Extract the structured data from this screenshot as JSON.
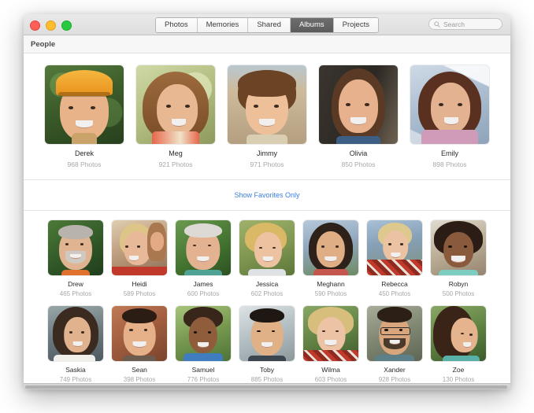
{
  "window": {
    "traffic_lights": [
      "close",
      "minimize",
      "zoom"
    ],
    "tabs": [
      {
        "label": "Photos",
        "selected": false
      },
      {
        "label": "Memories",
        "selected": false
      },
      {
        "label": "Shared",
        "selected": false
      },
      {
        "label": "Albums",
        "selected": true
      },
      {
        "label": "Projects",
        "selected": false
      }
    ],
    "search": {
      "placeholder": "Search",
      "value": ""
    }
  },
  "section": {
    "title": "People"
  },
  "favorites_link": {
    "label": "Show Favorites Only",
    "color": "#3b7fe0"
  },
  "favorites": [
    {
      "name": "Derek",
      "count": "968 Photos",
      "art": {
        "bg1": "#4a6b35",
        "bg2": "#2e4722",
        "skin": "#e8b389",
        "hair": "#6d523c",
        "cloth": "#caa36b",
        "helmet": "#f0a128",
        "helmet_on": true
      }
    },
    {
      "name": "Meg",
      "count": "921 Photos",
      "art": {
        "bg1": "#c3cf9a",
        "bg2": "#9aa96d",
        "skin": "#e7b892",
        "hair": "#8a5c33",
        "cloth": "#e8654a",
        "helmet_on": false
      }
    },
    {
      "name": "Jimmy",
      "count": "971 Photos",
      "art": {
        "bg1": "#cbb79a",
        "bg2": "#b6a184",
        "skin": "#eec09a",
        "hair": "#6b4426",
        "cloth": "#d9cdb2",
        "helmet_on": false
      }
    },
    {
      "name": "Olivia",
      "count": "850 Photos",
      "art": {
        "bg1": "#4a443c",
        "bg2": "#2a2622",
        "skin": "#e6b18c",
        "hair": "#5a3a24",
        "cloth": "#3d5f86",
        "helmet_on": false
      }
    },
    {
      "name": "Emily",
      "count": "898 Photos",
      "art": {
        "bg1": "#c7d4e2",
        "bg2": "#9aaec4",
        "skin": "#e3b291",
        "hair": "#5a3120",
        "cloth": "#cf9bb8",
        "helmet_on": false
      }
    }
  ],
  "people_rows": [
    [
      {
        "name": "Drew",
        "count": "465 Photos",
        "art": {
          "bg1": "#3f6b34",
          "bg2": "#24461f",
          "skin": "#e0b391",
          "hair": "#b9b3ad",
          "cloth": "#e0712f"
        }
      },
      {
        "name": "Heidi",
        "count": "589 Photos",
        "art": {
          "bg1": "#d8c2a5",
          "bg2": "#9a7a5e",
          "skin": "#e8b998",
          "hair": "#ddc487",
          "cloth": "#c0392b"
        }
      },
      {
        "name": "James",
        "count": "600 Photos",
        "art": {
          "bg1": "#5a8a47",
          "bg2": "#37602d",
          "skin": "#e3b391",
          "hair": "#dddad5",
          "cloth": "#4fa394"
        }
      },
      {
        "name": "Jessica",
        "count": "602 Photos",
        "art": {
          "bg1": "#8fa35e",
          "bg2": "#5f7a3c",
          "skin": "#ecc2a0",
          "hair": "#d9b866",
          "cloth": "#dfe2e4"
        }
      },
      {
        "name": "Meghann",
        "count": "590 Photos",
        "art": {
          "bg1": "#a9bcd0",
          "bg2": "#6e8aa4",
          "skin": "#e0ae84",
          "hair": "#2e2119",
          "cloth": "#c4564e"
        }
      },
      {
        "name": "Rebecca",
        "count": "450 Photos",
        "art": {
          "bg1": "#9fb6cc",
          "bg2": "#6d8498",
          "skin": "#ebc3a3",
          "hair": "#ddc98e",
          "cloth": "#c0392b"
        }
      },
      {
        "name": "Robyn",
        "count": "500 Photos",
        "art": {
          "bg1": "#d8d2c6",
          "bg2": "#a89a86",
          "skin": "#8a5a3c",
          "hair": "#2b1d16",
          "cloth": "#7ecdc2"
        }
      }
    ],
    [
      {
        "name": "Saskia",
        "count": "749 Photos",
        "art": {
          "bg1": "#8e9b9d",
          "bg2": "#5d6b70",
          "skin": "#e0b28e",
          "hair": "#3b2a20",
          "cloth": "#f0efec"
        }
      },
      {
        "name": "Sean",
        "count": "398 Photos",
        "art": {
          "bg1": "#b06a4c",
          "bg2": "#8a4c33",
          "skin": "#e6b089",
          "hair": "#2b1c14",
          "cloth": "#6c5c50"
        }
      },
      {
        "name": "Samuel",
        "count": "776 Photos",
        "art": {
          "bg1": "#8fae6a",
          "bg2": "#5f7f44",
          "skin": "#8f5c3c",
          "hair": "#38261a",
          "cloth": "#3f7cc0"
        }
      },
      {
        "name": "Toby",
        "count": "885 Photos",
        "art": {
          "bg1": "#cfd6d8",
          "bg2": "#9aa6aa",
          "skin": "#e0b086",
          "hair": "#1f1712",
          "cloth": "#3a4550"
        }
      },
      {
        "name": "Wilma",
        "count": "603 Photos",
        "art": {
          "bg1": "#6f8a4e",
          "bg2": "#48602f",
          "skin": "#ecc3a4",
          "hair": "#d8be7d",
          "cloth": "#c0392b"
        }
      },
      {
        "name": "Xander",
        "count": "928 Photos",
        "art": {
          "bg1": "#9aa08e",
          "bg2": "#6b7060",
          "skin": "#d8a57c",
          "hair": "#2b1f16",
          "cloth": "#5d7f87",
          "glasses": true
        }
      },
      {
        "name": "Zoe",
        "count": "130 Photos",
        "art": {
          "bg1": "#6f8b4f",
          "bg2": "#44602f",
          "skin": "#e5b48e",
          "hair": "#3a2418",
          "cloth": "#58b0a8"
        }
      }
    ]
  ]
}
